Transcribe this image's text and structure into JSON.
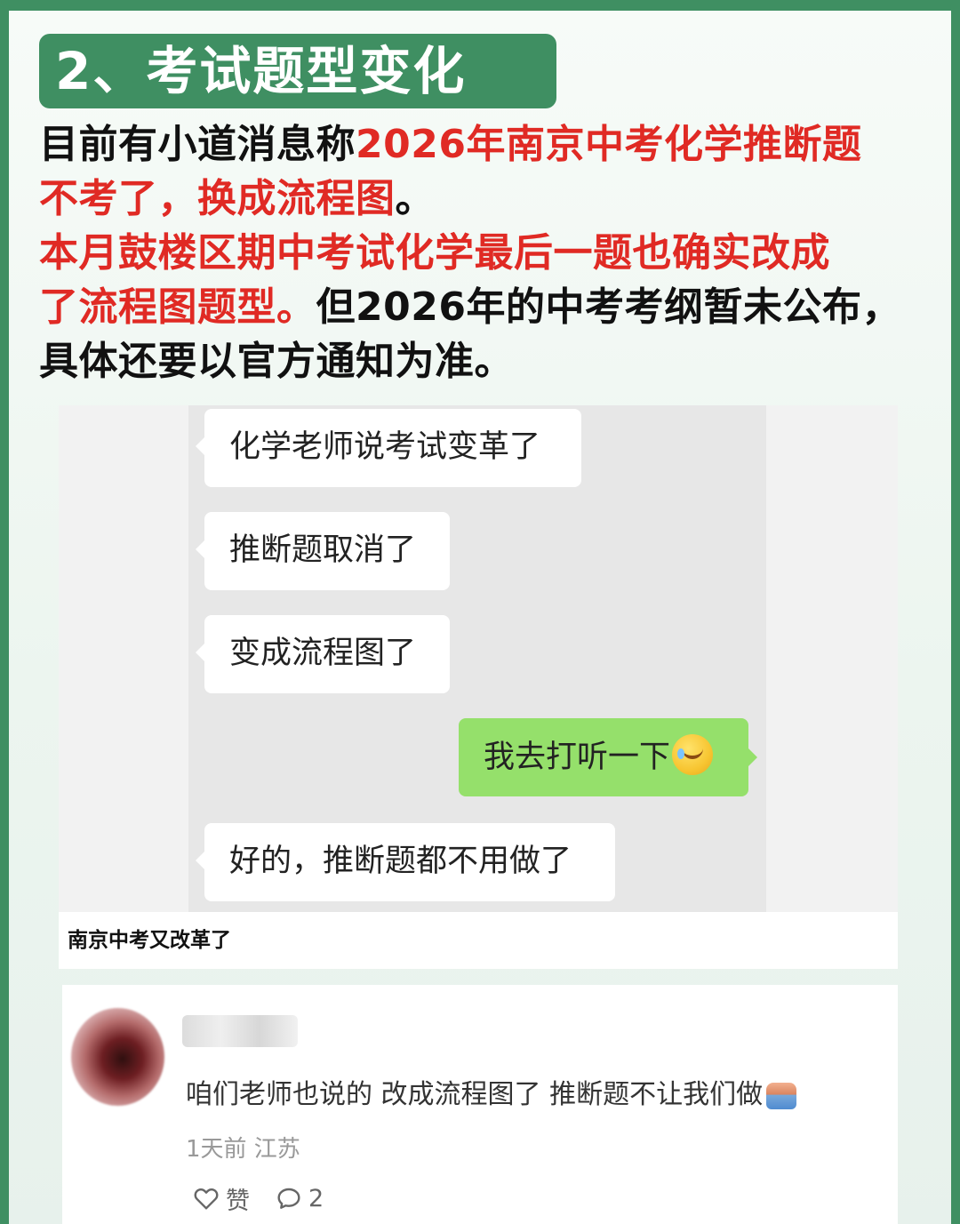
{
  "heading": {
    "title": "2、考试题型变化"
  },
  "intro": {
    "line1_black": "目前有小道消息称",
    "line1_red": "2026年南京中考化学推断题",
    "line2_red": "不考了，换成流程图",
    "line2_black": "。",
    "line3_red": "本月鼓楼区期中考试化学最后一题也确实改成",
    "line4_red": "了流程图题型。",
    "line4_black": "但2026年的中考考纲暂未公布，",
    "line5_black": "具体还要以官方通知为准。"
  },
  "chat": {
    "messages": [
      {
        "side": "left",
        "text": "化学老师说考试变革了"
      },
      {
        "side": "left",
        "text": "推断题取消了"
      },
      {
        "side": "left",
        "text": "变成流程图了"
      },
      {
        "side": "right",
        "text": "我去打听一下",
        "emoji": "crying-laughing-emoji"
      },
      {
        "side": "left",
        "text": "好的，推断题都不用做了"
      }
    ],
    "caption": "南京中考又改革了"
  },
  "comment": {
    "text": "咱们老师也说的 改成流程图了 推断题不让我们做",
    "emoji": "bathtub-emoji",
    "meta": "1天前 江苏",
    "like_label": "赞",
    "reply_count": "2"
  },
  "colors": {
    "brand_green": "#3f8f62",
    "highlight_red": "#e02a24",
    "chat_bubble_green": "#95e06b"
  }
}
